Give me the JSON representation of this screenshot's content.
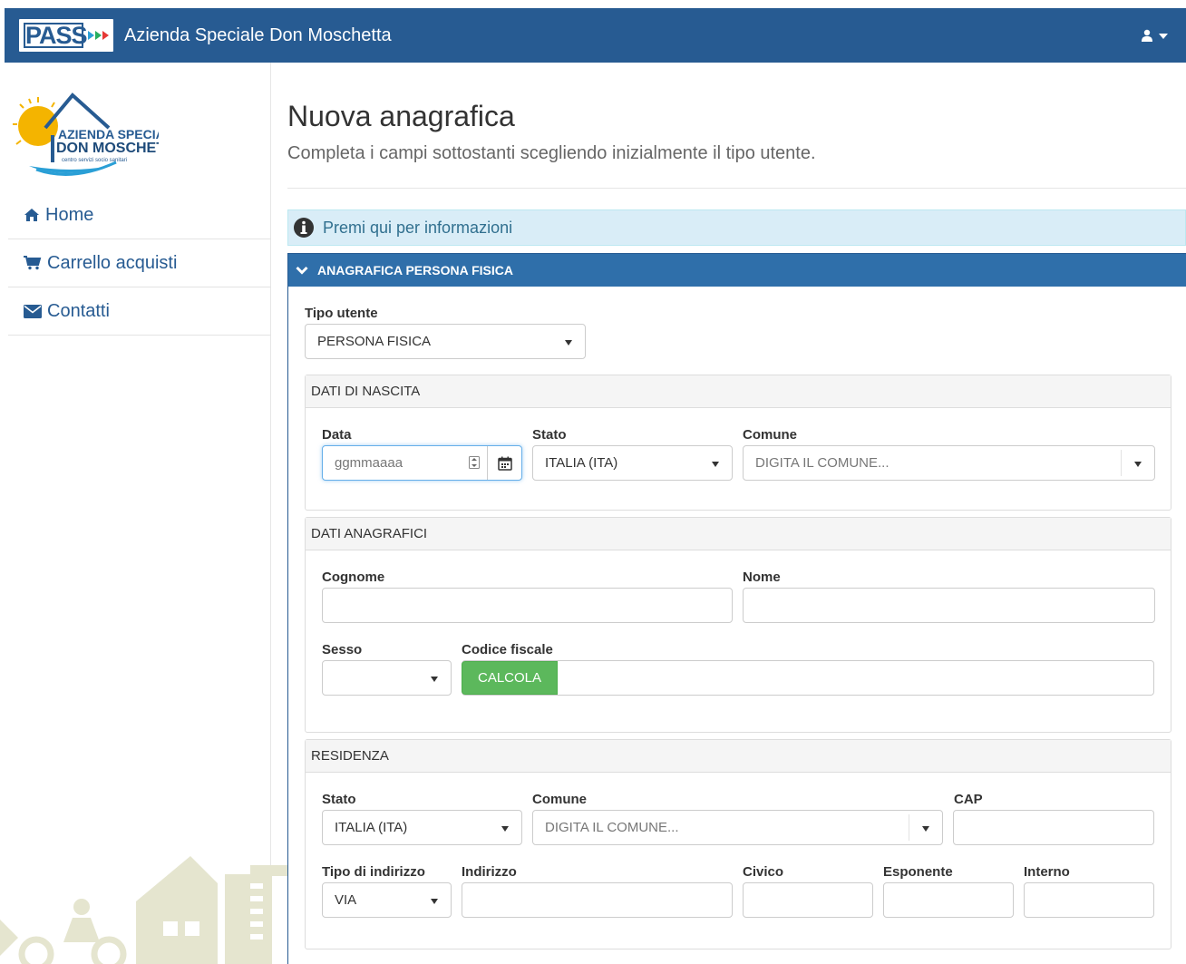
{
  "navbar": {
    "brand_text": "PASS",
    "app_title": "Azienda Speciale Don Moschetta"
  },
  "sidebar": {
    "logo_lines": [
      "AZIENDA SPECIALE",
      "DON MOSCHETTA",
      "centro servizi socio sanitari"
    ],
    "items": [
      {
        "label": "Home",
        "icon": "home-icon"
      },
      {
        "label": "Carrello acquisti",
        "icon": "cart-icon"
      },
      {
        "label": "Contatti",
        "icon": "envelope-icon"
      }
    ]
  },
  "page": {
    "title": "Nuova anagrafica",
    "subtitle": "Completa i campi sottostanti scegliendo inizialmente il tipo utente.",
    "info_text": "Premi qui per informazioni"
  },
  "panel": {
    "heading": "ANAGRAFICA PERSONA FISICA",
    "tipo_utente": {
      "label": "Tipo utente",
      "value": "PERSONA FISICA"
    },
    "nascita": {
      "heading": "DATI DI NASCITA",
      "data_label": "Data",
      "data_placeholder": "ggmmaaaa",
      "stato_label": "Stato",
      "stato_value": "ITALIA (ITA)",
      "comune_label": "Comune",
      "comune_placeholder": "DIGITA IL COMUNE..."
    },
    "anagrafici": {
      "heading": "DATI ANAGRAFICI",
      "cognome_label": "Cognome",
      "nome_label": "Nome",
      "sesso_label": "Sesso",
      "cf_label": "Codice fiscale",
      "calcola_label": "CALCOLA"
    },
    "residenza": {
      "heading": "RESIDENZA",
      "stato_label": "Stato",
      "stato_value": "ITALIA (ITA)",
      "comune_label": "Comune",
      "comune_placeholder": "DIGITA IL COMUNE...",
      "cap_label": "CAP",
      "tipo_indirizzo_label": "Tipo di indirizzo",
      "tipo_indirizzo_value": "VIA",
      "indirizzo_label": "Indirizzo",
      "civico_label": "Civico",
      "esponente_label": "Esponente",
      "interno_label": "Interno"
    }
  },
  "colors": {
    "navbar": "#275b92",
    "panel_header": "#2f6faa",
    "info_bg": "#d9edf7",
    "calc_button": "#5cb85c"
  }
}
